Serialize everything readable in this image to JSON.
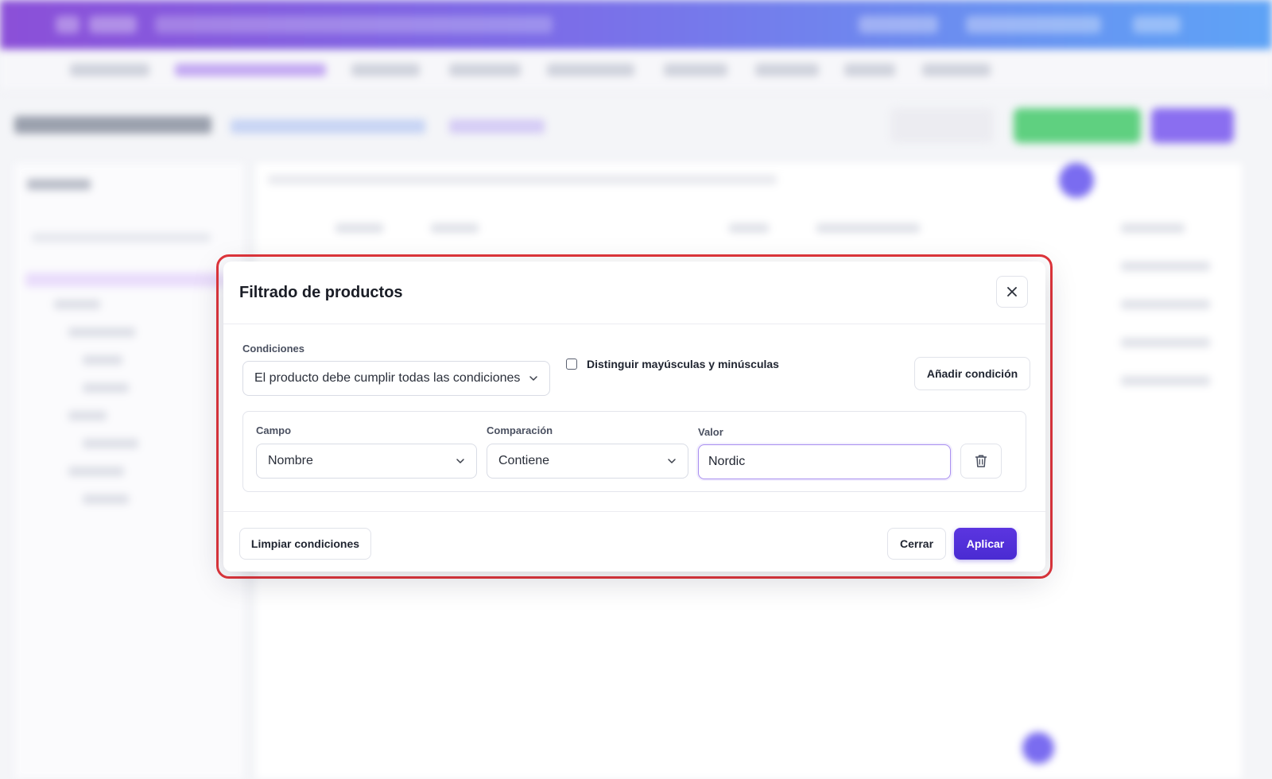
{
  "modal": {
    "title": "Filtrado de productos",
    "conditions_label": "Condiciones",
    "match_mode": "El producto debe cumplir todas las condiciones",
    "case_sensitive_label": "Distinguir mayúsculas y minúsculas",
    "case_sensitive_checked": false,
    "add_condition_label": "Añadir condición",
    "condition": {
      "field_label": "Campo",
      "field_value": "Nombre",
      "comparison_label": "Comparación",
      "comparison_value": "Contiene",
      "value_label": "Valor",
      "value": "Nordic"
    },
    "footer": {
      "clear_label": "Limpiar condiciones",
      "close_label": "Cerrar",
      "apply_label": "Aplicar"
    }
  },
  "colors": {
    "primary": "#4a2bd2",
    "highlight": "#e0353b",
    "topbar_start": "#8b4fd8",
    "topbar_end": "#5ea3f6"
  }
}
